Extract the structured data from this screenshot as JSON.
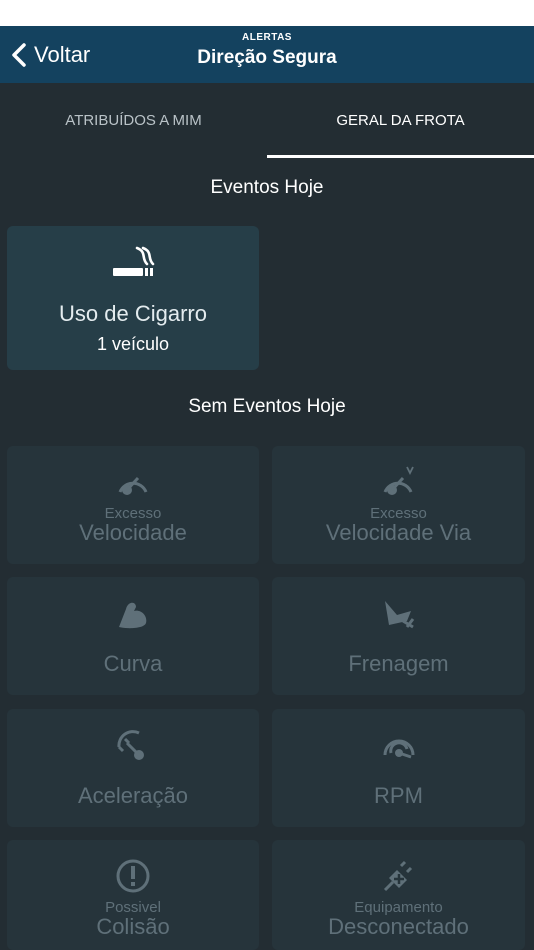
{
  "colors": {
    "navbar": "#14425f",
    "background": "#232d33",
    "card_active": "#263e48",
    "card_inactive": "#26343b",
    "muted_text": "#5f7079"
  },
  "header": {
    "back_label": "Voltar",
    "subtitle": "ALERTAS",
    "title": "Direção Segura"
  },
  "tabs": [
    {
      "label": "ATRIBUÍDOS A MIM",
      "selected": false
    },
    {
      "label": "GERAL DA FROTA",
      "selected": true
    }
  ],
  "events_today": {
    "title": "Eventos Hoje",
    "cards": [
      {
        "icon": "smoking-icon",
        "label": "Uso de Cigarro",
        "count": "1 veículo"
      }
    ]
  },
  "no_events_today": {
    "title": "Sem Eventos Hoje",
    "cards": [
      {
        "icon": "speedometer-icon",
        "small": "Excesso",
        "label": "Velocidade"
      },
      {
        "icon": "road-speedometer-icon",
        "small": "Excesso",
        "label": "Velocidade Via"
      },
      {
        "icon": "curve-icon",
        "small": "",
        "label": "Curva"
      },
      {
        "icon": "braking-icon",
        "small": "",
        "label": "Frenagem"
      },
      {
        "icon": "acceleration-icon",
        "small": "",
        "label": "Aceleração"
      },
      {
        "icon": "rpm-icon",
        "small": "",
        "label": "RPM"
      },
      {
        "icon": "collision-warning-icon",
        "small": "Possivel",
        "label": "Colisão"
      },
      {
        "icon": "disconnected-plug-icon",
        "small": "Equipamento",
        "label": "Desconectado"
      }
    ]
  }
}
